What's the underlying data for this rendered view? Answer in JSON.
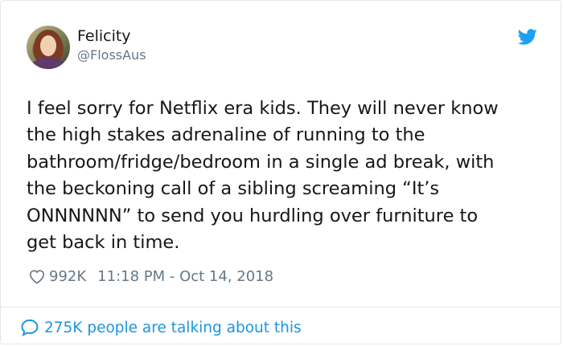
{
  "user": {
    "name": "Felicity",
    "handle": "@FlossAus"
  },
  "tweet": {
    "text": "I feel sorry for Netflix era kids. They will never know\nthe high stakes adrenaline of running to the\nbathroom/fridge/bedroom in a single ad break, with\nthe beckoning call of a sibling screaming “It’s\nONNNNNN” to send you hurdling over furniture to\nget back in time.",
    "likes": "992K",
    "timestamp": "11:18 PM - Oct 14, 2018"
  },
  "footer": {
    "talking": "275K people are talking about this"
  },
  "icons": {
    "brand": "twitter-bird-icon",
    "like": "heart-icon",
    "talk": "speech-bubble-icon"
  },
  "colors": {
    "twitter_blue": "#1da1f2",
    "link_blue": "#1b95e0",
    "muted": "#657786",
    "text": "#14171a",
    "border": "#e1e8ed"
  }
}
